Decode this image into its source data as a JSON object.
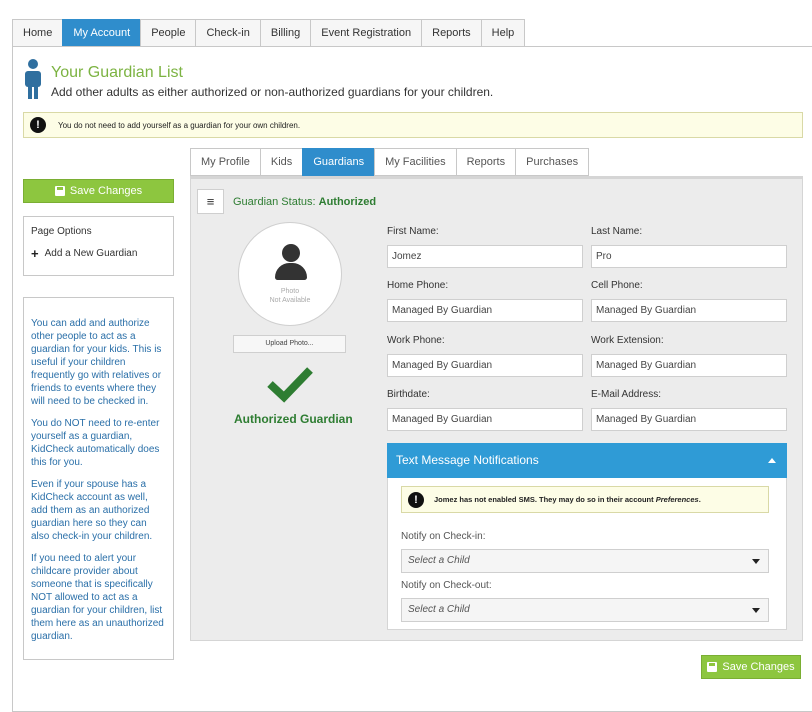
{
  "nav": {
    "tabs": [
      {
        "label": "Home"
      },
      {
        "label": "My Account"
      },
      {
        "label": "People"
      },
      {
        "label": "Check-in"
      },
      {
        "label": "Billing"
      },
      {
        "label": "Event Registration"
      },
      {
        "label": "Reports"
      },
      {
        "label": "Help"
      }
    ],
    "active": "My Account"
  },
  "header": {
    "title": "Your Guardian List",
    "subtitle": "Add other adults as either authorized or non-authorized guardians for your children."
  },
  "alert": {
    "text": "You do not need to add yourself as a guardian for your own children."
  },
  "subtabs": {
    "tabs": [
      {
        "label": "My Profile"
      },
      {
        "label": "Kids"
      },
      {
        "label": "Guardians"
      },
      {
        "label": "My Facilities"
      },
      {
        "label": "Reports"
      },
      {
        "label": "Purchases"
      }
    ],
    "active": "Guardians"
  },
  "sidebar": {
    "save_label": "Save Changes",
    "options_title": "Page Options",
    "add_guardian_label": "Add a New Guardian",
    "help": [
      "You can add and authorize other people to act as a guardian for your kids. This is useful if your children frequently go with relatives or friends to events where they will need to be checked in.",
      "You do NOT need to re-enter yourself as a guardian, KidCheck automatically does this for you.",
      "Even if your spouse has a KidCheck account as well, add them as an authorized guardian here so they can also check-in your children.",
      "If you need to alert your childcare provider about someone that is specifically NOT allowed to act as a guardian for your children, list them here as an unauthorized guardian."
    ]
  },
  "guardian": {
    "status_label": "Guardian Status:",
    "status_value": "Authorized",
    "photo_caption_1": "Photo",
    "photo_caption_2": "Not Available",
    "upload_label": "Upload Photo...",
    "authorized_label": "Authorized Guardian",
    "fields": {
      "first_name": {
        "label": "First Name:",
        "value": "Jomez"
      },
      "last_name": {
        "label": "Last Name:",
        "value": "Pro"
      },
      "home_phone": {
        "label": "Home Phone:",
        "value": "Managed By Guardian"
      },
      "cell_phone": {
        "label": "Cell Phone:",
        "value": "Managed By Guardian"
      },
      "work_phone": {
        "label": "Work Phone:",
        "value": "Managed By Guardian"
      },
      "work_extension": {
        "label": "Work Extension:",
        "value": "Managed By Guardian"
      },
      "birthdate": {
        "label": "Birthdate:",
        "value": "Managed By Guardian"
      },
      "email": {
        "label": "E-Mail Address:",
        "value": "Managed By Guardian"
      }
    }
  },
  "sms": {
    "title": "Text Message Notifications",
    "alert_text": "Jomez has not enabled SMS. They may do so in their account",
    "alert_link": "Preferences",
    "alert_end": ".",
    "checkin_label": "Notify on Check-in:",
    "checkin_value": "Select a Child",
    "checkout_label": "Notify on Check-out:",
    "checkout_value": "Select a Child"
  },
  "footer": {
    "save_label": "Save Changes"
  },
  "colors": {
    "accent_blue": "#2f8dcc",
    "save_green": "#8dc63f",
    "status_green": "#2e7d32",
    "title_green": "#7cb342"
  }
}
